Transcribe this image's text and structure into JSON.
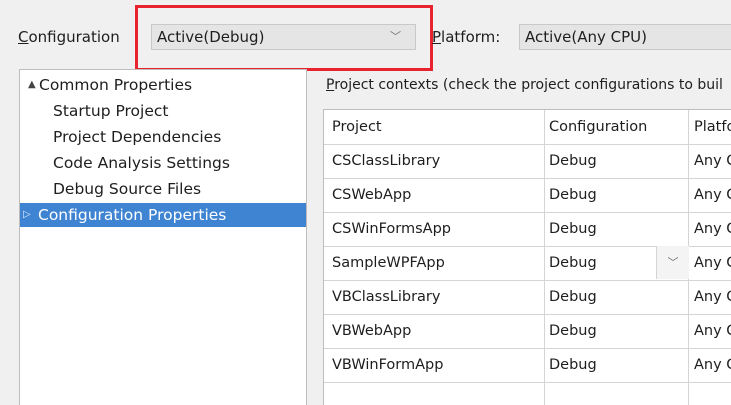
{
  "top": {
    "configuration_label_prefix": "C",
    "configuration_label_rest": "onfiguration",
    "configuration_value": "Active(Debug)",
    "platform_label_prefix": "P",
    "platform_label_rest": "latform:",
    "platform_value": "Active(Any CPU)"
  },
  "tree": {
    "items": [
      {
        "label": "Common Properties",
        "expander": "▲"
      },
      {
        "label": "Startup Project"
      },
      {
        "label": "Project Dependencies"
      },
      {
        "label": "Code Analysis Settings"
      },
      {
        "label": "Debug Source Files"
      },
      {
        "label": "Configuration Properties",
        "expander": "▷"
      }
    ]
  },
  "contexts": {
    "label_prefix": "P",
    "label_rest": "roject contexts (check the project configurations to buil"
  },
  "grid": {
    "headers": [
      "Project",
      "Configuration",
      "Platfo"
    ],
    "rows": [
      [
        "CSClassLibrary",
        "Debug",
        "Any C"
      ],
      [
        "CSWebApp",
        "Debug",
        "Any C"
      ],
      [
        "CSWinFormsApp",
        "Debug",
        "Any C"
      ],
      [
        "SampleWPFApp",
        "Debug",
        "Any C"
      ],
      [
        "VBClassLibrary",
        "Debug",
        "Any C"
      ],
      [
        "VBWebApp",
        "Debug",
        "Any C"
      ],
      [
        "VBWinFormApp",
        "Debug",
        "Any C"
      ]
    ]
  },
  "icons": {
    "chevron": "﹀"
  },
  "colors": {
    "highlight": "#e8232f",
    "selection": "#3f84d3"
  }
}
